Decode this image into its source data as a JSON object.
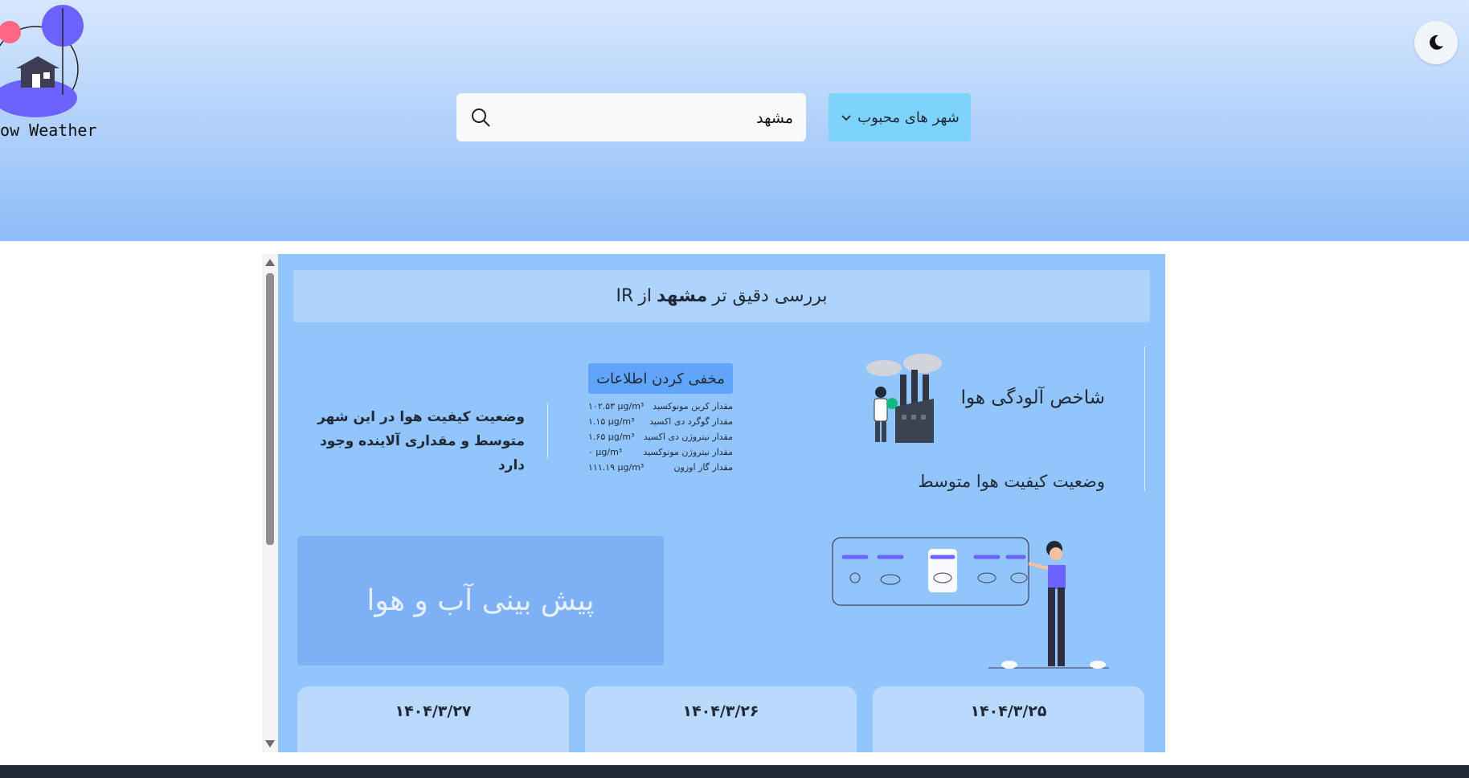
{
  "logo": {
    "text": "now Weather"
  },
  "search": {
    "value": "مشهد",
    "placeholder": ""
  },
  "favorites": {
    "label": "شهر های محبوب"
  },
  "panel": {
    "title_prefix": "بررسی دقیق تر",
    "title_city": "مشهد",
    "title_mid": "از",
    "title_country": "IR"
  },
  "air_quality": {
    "title": "شاخص آلودگی هوا",
    "status": "وضعیت کیفیت هوا متوسط",
    "hide_button": "مخفی کردن اطلاعات",
    "pollutants": [
      {
        "label": "مقدار کربن مونوکسید",
        "value": "۱۰۲.۵۳ µg/m³"
      },
      {
        "label": "مقدار گوگرد دی اکسید",
        "value": "۱.۱۵ µg/m³"
      },
      {
        "label": "مقدار نیتروژن دی اکسید",
        "value": "۱.۶۵ µg/m³"
      },
      {
        "label": "مقدار نیتروژن مونوکسید",
        "value": "۰ µg/m³"
      },
      {
        "label": "مقدار گاز اوزون",
        "value": "۱۱۱.۱۹ µg/m³"
      }
    ],
    "description_line1": "وضعیت کیفیت هوا در این شهر",
    "description_line2": "متوسط و مقداری آلاینده وجود دارد"
  },
  "forecast": {
    "title": "پیش بینی آب و هوا"
  },
  "days": [
    {
      "date": "۱۴۰۴/۳/۲۵"
    },
    {
      "date": "۱۴۰۴/۳/۲۶"
    },
    {
      "date": "۱۴۰۴/۳/۲۷"
    }
  ],
  "colors": {
    "header_top": "#d7e7fe",
    "header_bottom": "#8dbcf7",
    "panel": "#93c5fd",
    "accent": "#6366f1",
    "favorites_button": "#7dd3fc"
  }
}
